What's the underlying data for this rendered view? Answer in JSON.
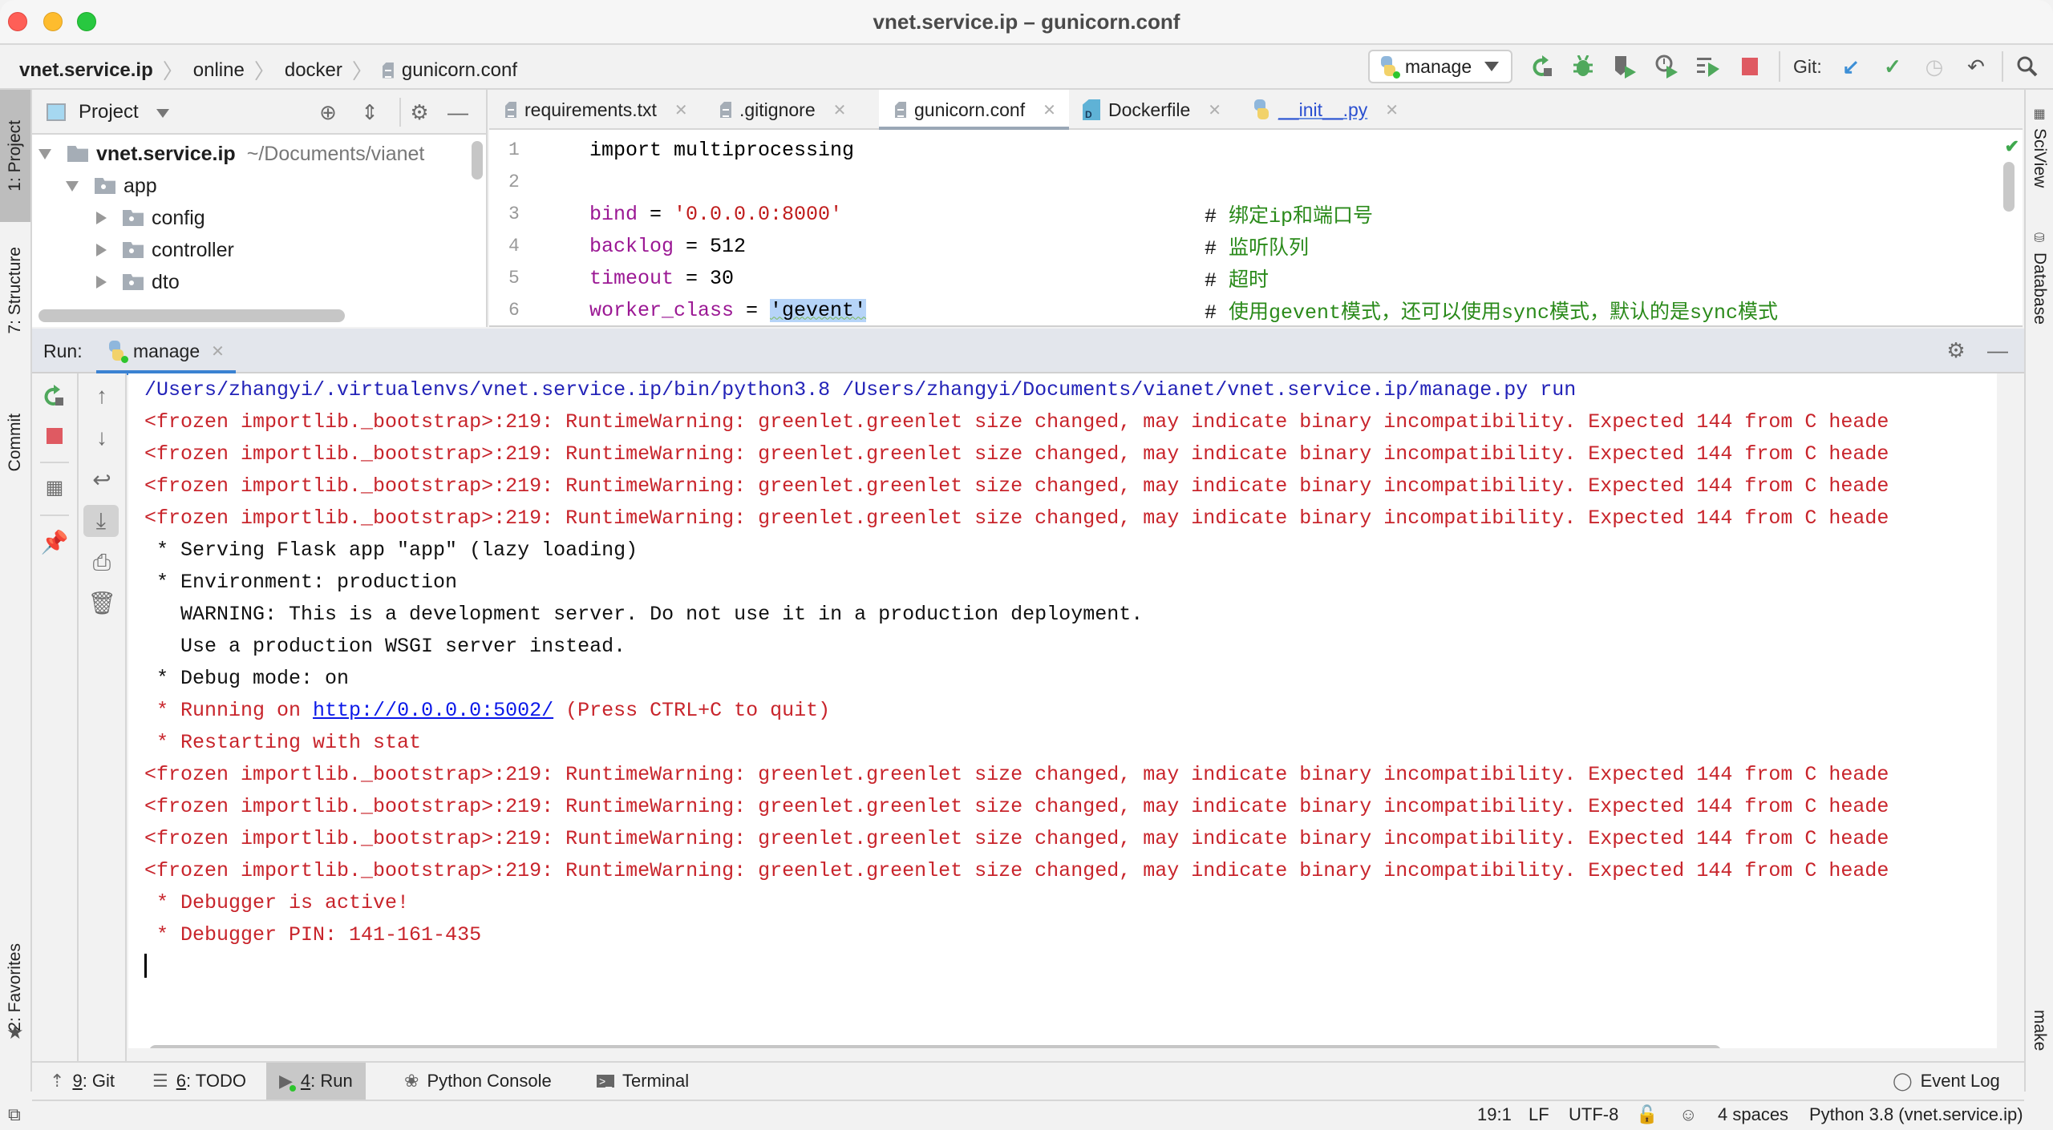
{
  "window": {
    "title": "vnet.service.ip – gunicorn.conf"
  },
  "breadcrumb": [
    "vnet.service.ip",
    "online",
    "docker",
    "gunicorn.conf"
  ],
  "toolbar": {
    "run_config": "manage",
    "git_label": "Git:",
    "icons": [
      "rerun-icon",
      "debug-icon",
      "coverage-icon",
      "profile-icon",
      "concurrency-icon",
      "stop-icon",
      "git-update-icon",
      "git-commit-icon",
      "git-history-icon",
      "git-rollback-icon",
      "search-icon"
    ]
  },
  "left_stripe": {
    "project": "1: Project",
    "structure": "7: Structure",
    "commit": "Commit",
    "favorites": "2: Favorites"
  },
  "right_stripe": {
    "sciview": "SciView",
    "database": "Database",
    "make": "make"
  },
  "project_panel": {
    "title": "Project",
    "tree": [
      {
        "label": "vnet.service.ip",
        "path": "~/Documents/vianet",
        "depth": 0,
        "expanded": true,
        "bold": true
      },
      {
        "label": "app",
        "depth": 1,
        "expanded": true
      },
      {
        "label": "config",
        "depth": 2,
        "expanded": false
      },
      {
        "label": "controller",
        "depth": 2,
        "expanded": false
      },
      {
        "label": "dto",
        "depth": 2,
        "expanded": false
      }
    ]
  },
  "editor": {
    "tabs": [
      {
        "name": "requirements.txt",
        "active": false
      },
      {
        "name": ".gitignore",
        "active": false
      },
      {
        "name": "gunicorn.conf",
        "active": true
      },
      {
        "name": "Dockerfile",
        "active": false
      },
      {
        "name": "__init__.py",
        "active": false
      }
    ],
    "lines": [
      {
        "n": "1",
        "code": "import multiprocessing",
        "comment": ""
      },
      {
        "n": "2",
        "code": "",
        "comment": ""
      },
      {
        "n": "3",
        "var": "bind",
        "op": " = ",
        "value": "'0.0.0.0:8000'",
        "comment": "绑定ip和端口号"
      },
      {
        "n": "4",
        "var": "backlog",
        "op": " = ",
        "value": "512",
        "comment": "监听队列"
      },
      {
        "n": "5",
        "var": "timeout",
        "op": " = ",
        "value": "30",
        "comment": "超时"
      },
      {
        "n": "6",
        "var": "worker_class",
        "op": " = ",
        "value": "'gevent'",
        "comment": "使用gevent模式，还可以使用sync模式，默认的是sync模式"
      }
    ]
  },
  "run_panel": {
    "label": "Run:",
    "tab": "manage",
    "console": [
      {
        "type": "cmd",
        "text": "/Users/zhangyi/.virtualenvs/vnet.service.ip/bin/python3.8 /Users/zhangyi/Documents/vianet/vnet.service.ip/manage.py run"
      },
      {
        "type": "err",
        "text": "<frozen importlib._bootstrap>:219: RuntimeWarning: greenlet.greenlet size changed, may indicate binary incompatibility. Expected 144 from C heade"
      },
      {
        "type": "err",
        "text": "<frozen importlib._bootstrap>:219: RuntimeWarning: greenlet.greenlet size changed, may indicate binary incompatibility. Expected 144 from C heade"
      },
      {
        "type": "err",
        "text": "<frozen importlib._bootstrap>:219: RuntimeWarning: greenlet.greenlet size changed, may indicate binary incompatibility. Expected 144 from C heade"
      },
      {
        "type": "err",
        "text": "<frozen importlib._bootstrap>:219: RuntimeWarning: greenlet.greenlet size changed, may indicate binary incompatibility. Expected 144 from C heade"
      },
      {
        "type": "out",
        "text": " * Serving Flask app \"app\" (lazy loading)"
      },
      {
        "type": "out",
        "text": " * Environment: production"
      },
      {
        "type": "out",
        "text": "   WARNING: This is a development server. Do not use it in a production deployment."
      },
      {
        "type": "out",
        "text": "   Use a production WSGI server instead."
      },
      {
        "type": "out",
        "text": " * Debug mode: on"
      },
      {
        "type": "link",
        "prefix": " * Running on ",
        "link": "http://0.0.0.0:5002/",
        "suffix": " (Press CTRL+C to quit)"
      },
      {
        "type": "err",
        "text": " * Restarting with stat"
      },
      {
        "type": "err",
        "text": "<frozen importlib._bootstrap>:219: RuntimeWarning: greenlet.greenlet size changed, may indicate binary incompatibility. Expected 144 from C heade"
      },
      {
        "type": "err",
        "text": "<frozen importlib._bootstrap>:219: RuntimeWarning: greenlet.greenlet size changed, may indicate binary incompatibility. Expected 144 from C heade"
      },
      {
        "type": "err",
        "text": "<frozen importlib._bootstrap>:219: RuntimeWarning: greenlet.greenlet size changed, may indicate binary incompatibility. Expected 144 from C heade"
      },
      {
        "type": "err",
        "text": "<frozen importlib._bootstrap>:219: RuntimeWarning: greenlet.greenlet size changed, may indicate binary incompatibility. Expected 144 from C heade"
      },
      {
        "type": "err",
        "text": " * Debugger is active!"
      },
      {
        "type": "err",
        "text": " * Debugger PIN: 141-161-435"
      }
    ]
  },
  "tool_windows": [
    {
      "key": "9",
      "label": ": Git",
      "icon": "git-icon"
    },
    {
      "key": "6",
      "label": ": TODO",
      "icon": "todo-icon"
    },
    {
      "key": "4",
      "label": ": Run",
      "icon": "run-icon",
      "active": true
    },
    {
      "key": "",
      "label": "Python Console",
      "icon": "python-console-icon"
    },
    {
      "key": "",
      "label": "Terminal",
      "icon": "terminal-icon"
    }
  ],
  "event_log": "Event Log",
  "status": {
    "position": "19:1",
    "line_sep": "LF",
    "encoding": "UTF-8",
    "indent": "4 spaces",
    "interpreter": "Python 3.8 (vnet.service.ip)"
  },
  "colors": {
    "accent": "#3b82d2",
    "error_text": "#c8242b",
    "command_text": "#2323b8",
    "comment_text": "#2a8a1a",
    "stop_red": "#df5a62",
    "run_green": "#4fa85c"
  }
}
